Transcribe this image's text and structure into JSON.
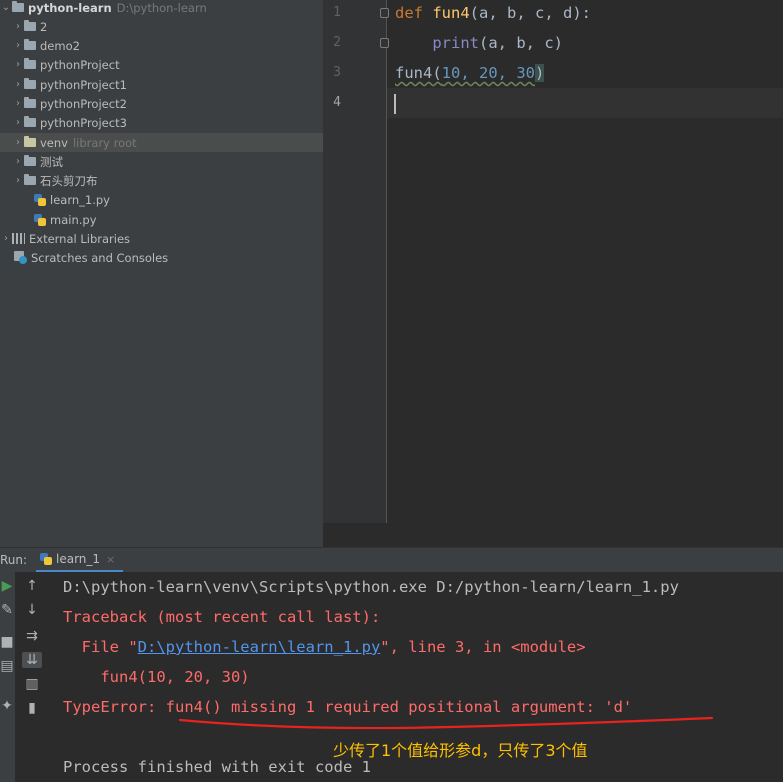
{
  "project": {
    "root": {
      "name": "python-learn",
      "path": "D:\\python-learn"
    },
    "items": [
      {
        "label": "2",
        "type": "folder"
      },
      {
        "label": "demo2",
        "type": "folder"
      },
      {
        "label": "pythonProject",
        "type": "folder"
      },
      {
        "label": "pythonProject1",
        "type": "folder"
      },
      {
        "label": "pythonProject2",
        "type": "folder"
      },
      {
        "label": "pythonProject3",
        "type": "folder"
      },
      {
        "label": "venv",
        "hint": "library root",
        "type": "folder"
      },
      {
        "label": "测试",
        "type": "folder"
      },
      {
        "label": "石头剪刀布",
        "type": "folder"
      },
      {
        "label": "learn_1.py",
        "type": "file"
      },
      {
        "label": "main.py",
        "type": "file"
      },
      {
        "label": "External Libraries",
        "type": "libs"
      },
      {
        "label": "Scratches and Consoles",
        "type": "scratch"
      }
    ]
  },
  "editor": {
    "line_numbers": [
      "1",
      "2",
      "3",
      "4"
    ],
    "code": {
      "l1_kw": "def",
      "l1_fn": "fun4",
      "l1_params": "(a, b, c, d):",
      "l2_builtin": "print",
      "l2_args": "(a, b, c)",
      "l3_call": "fun4(",
      "l3_args": "10, 20, 30",
      "l3_close": ")"
    },
    "colors": {
      "keyword": "#cc7832",
      "function": "#ffc66d",
      "builtin": "#8888c6",
      "number": "#6897bb"
    }
  },
  "run": {
    "label": "Run:",
    "tab": "learn_1",
    "tab_close": "×",
    "console": {
      "command": "D:\\python-learn\\venv\\Scripts\\python.exe D:/python-learn/learn_1.py",
      "traceback_header": "Traceback (most recent call last):",
      "file_prefix": "  File \"",
      "file_link": "D:\\python-learn\\learn_1.py",
      "file_suffix": "\", line 3, in <module>",
      "code_line": "    fun4(10, 20, 30)",
      "error_type": "TypeError: ",
      "error_msg": "fun4() missing 1 required positional argument: 'd'",
      "exit": "Process finished with exit code 1"
    },
    "colors": {
      "error": "#ff6b68",
      "link": "#5394ec"
    }
  },
  "annotation": {
    "text": "少传了1个值给形参d，只传了3个值",
    "color": "#ffc000"
  }
}
